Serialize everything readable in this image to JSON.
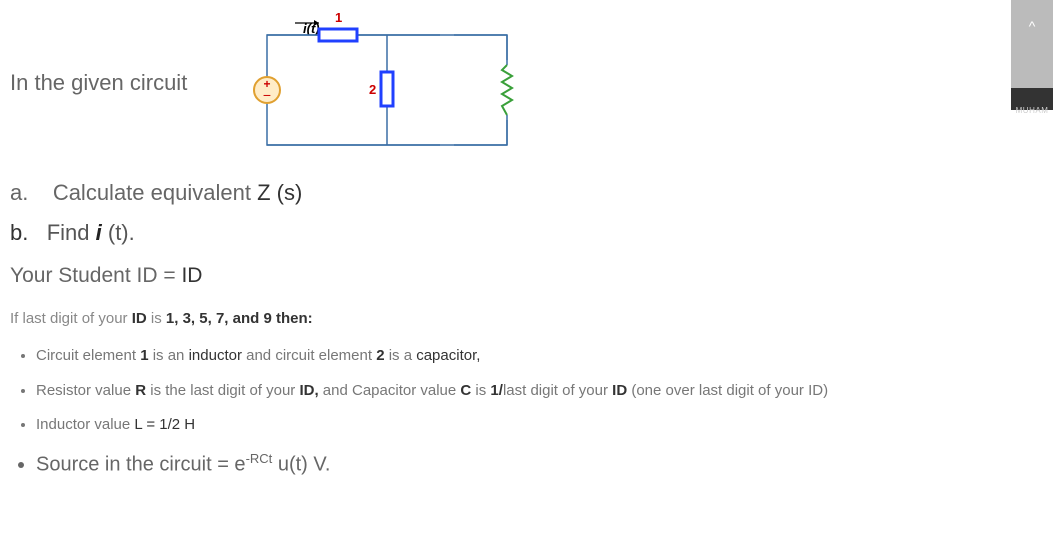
{
  "intro": "In the given circuit",
  "circuit": {
    "current_label": "i(t)",
    "source_symbol_top": "+",
    "source_symbol_bottom": "−",
    "element1_label": "1",
    "element2_label": "2"
  },
  "problem_a_prefix": "a.",
  "problem_a_text": "Calculate equivalent ",
  "problem_a_bold": "Z (s)",
  "problem_b_prefix": "b.",
  "problem_b_text": "Find ",
  "problem_b_italic": "i",
  "problem_b_rest": " (t).",
  "id_line_prefix": "Your Student ID = ",
  "id_line_bold": "ID",
  "condition_prefix": "If last digit of your ",
  "condition_bold1": "ID",
  "condition_mid": " is ",
  "condition_bold2": "1, 3, 5, 7, and 9 then:",
  "bullets": {
    "b1_p1": "Circuit element ",
    "b1_b1": "1",
    "b1_p2": " is an ",
    "b1_b2": "inductor",
    "b1_p3": " and circuit element ",
    "b1_b3": "2",
    "b1_p4": " is a ",
    "b1_b4": "capacitor,",
    "b2_p1": "Resistor value ",
    "b2_b1": "R",
    "b2_p2": " is the last digit of your ",
    "b2_b2": "ID,",
    "b2_p3": " and Capacitor value ",
    "b2_b3": "C",
    "b2_p4": " is ",
    "b2_b4": "1/",
    "b2_p5": "last digit of your ",
    "b2_b5": "ID",
    "b2_p6": " (one over last digit of your ID)",
    "b3_p1": "Inductor value ",
    "b3_b1": "L = 1/2 H",
    "b4_p1": "Source in the circuit = e",
    "b4_sup": "-RCt",
    "b4_p2": " u(t) V."
  },
  "thumbnail_name": "MUHAM",
  "thumbnail_chevron": "^"
}
